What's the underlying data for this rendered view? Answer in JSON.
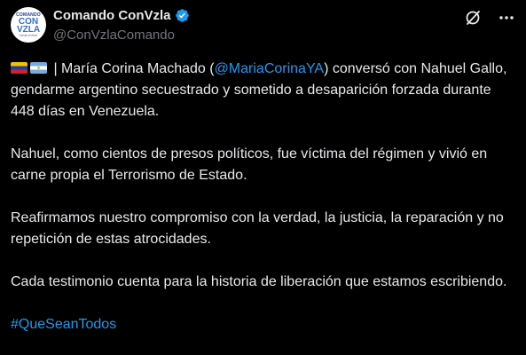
{
  "tweet": {
    "author": {
      "display_name": "Comando ConVzla",
      "handle": "@ConVzlaComando",
      "avatar": {
        "line1": "COMANDO",
        "line2a": "CON",
        "line2b": "VZLA",
        "line3": "hasta el final"
      },
      "verified_icon": "verified-badge-icon",
      "verified_color": "#1d9bf0"
    },
    "actions": {
      "grok_icon": "grok-icon",
      "more_icon": "more-dots-icon"
    },
    "paragraph1": {
      "flag1": "venezuela-flag",
      "flag2": "argentina-flag",
      "text_a": " | María Corina Machado (",
      "mention": "@MariaCorinaYA",
      "text_b": ") conversó con Nahuel Gallo, gendarme argentino secuestrado y sometido a desaparición forzada durante 448 días en Venezuela."
    },
    "paragraph2": "Nahuel, como cientos de presos políticos, fue víctima del régimen y vivió en carne propia el Terrorismo de Estado.",
    "paragraph3": "Reafirmamos nuestro compromiso con la verdad, la justicia, la reparación y no repetición de estas atrocidades.",
    "paragraph4": "Cada testimonio cuenta para la historia de liberación que estamos escribiendo.",
    "hashtag": "#QueSeanTodos",
    "link_color": "#1d9bf0"
  }
}
